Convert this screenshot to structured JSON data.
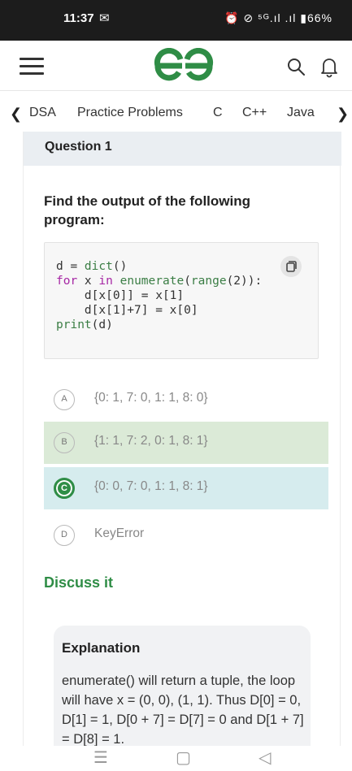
{
  "status": {
    "time": "11:37",
    "mail_icon": "M",
    "right": "⏰ 🔇 ᵛᵒˡᵗᵉ ⁺⁵ᴳ.ıl .ıl ▮66%"
  },
  "header": {
    "menu_icon": "hamburger-menu-icon",
    "logo": "geeksforgeeks-logo",
    "search_icon": "search-icon",
    "bell_icon": "bell-icon"
  },
  "topics": {
    "left_arrow": "❮",
    "right_arrow": "❯",
    "items": [
      "DSA",
      "Practice Problems",
      "C",
      "C++",
      "Java"
    ]
  },
  "question": {
    "number": "Question 1",
    "text": "Find the output of the following program:"
  },
  "options": [
    {
      "letter": "A",
      "text": "{0: 1, 7: 0, 1: 1, 8: 0}",
      "state": "none"
    },
    {
      "letter": "B",
      "text": "{1: 1, 7: 2, 0: 1, 8: 1}",
      "state": "highlighted"
    },
    {
      "letter": "C",
      "text": "{0: 0, 7: 0, 1: 1, 8: 1}",
      "state": "selected"
    },
    {
      "letter": "D",
      "text": "KeyError",
      "state": "none"
    }
  ],
  "discuss_label": "Discuss it",
  "explanation": {
    "title": "Explanation",
    "text": "enumerate() will return a tuple, the loop will have x = (0, 0), (1, 1). Thus D[0] = 0, D[1] = 1, D[0 + 7] = D[7] = 0 and D[1 + 7] = D[8] = 1."
  },
  "colors": {
    "accent": "#2f8d46",
    "highlight_green": "#dbead7",
    "highlight_teal": "#d6ecee"
  }
}
